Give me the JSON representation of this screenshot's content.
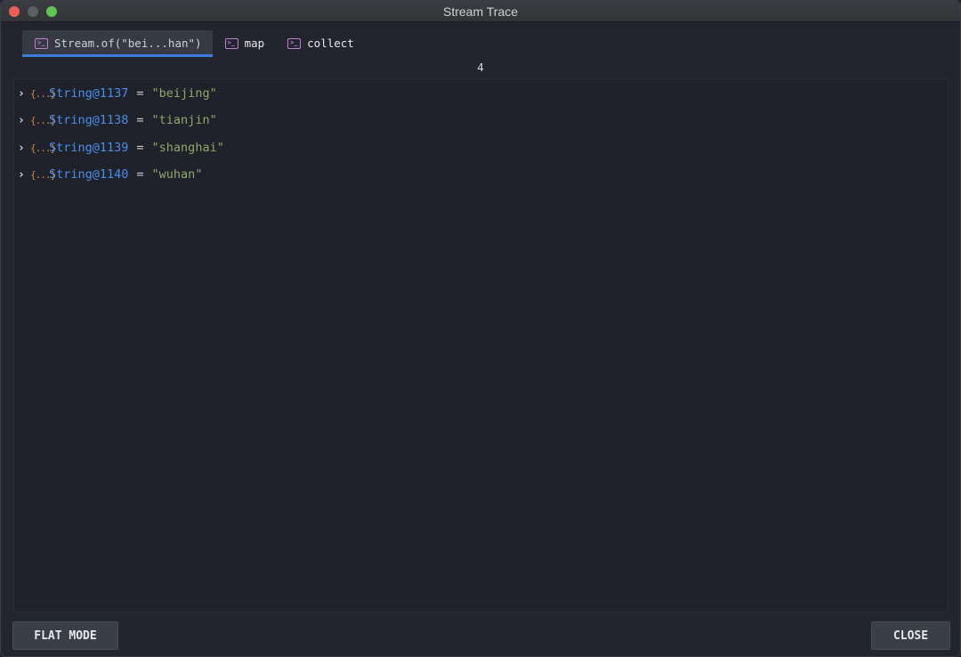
{
  "window": {
    "title": "Stream Trace"
  },
  "tabs": [
    {
      "label": "Stream.of(\"bei...han\")",
      "active": true
    },
    {
      "label": "map",
      "active": false
    },
    {
      "label": "collect",
      "active": false
    }
  ],
  "count": "4",
  "items": [
    {
      "ref": "String@1137",
      "eq": "=",
      "value": "\"beijing\""
    },
    {
      "ref": "String@1138",
      "eq": "=",
      "value": "\"tianjin\""
    },
    {
      "ref": "String@1139",
      "eq": "=",
      "value": "\"shanghai\""
    },
    {
      "ref": "String@1140",
      "eq": "=",
      "value": "\"wuhan\""
    }
  ],
  "buttons": {
    "flat_mode": "FLAT MODE",
    "close": "CLOSE"
  },
  "icons": {
    "tab": "console-icon",
    "expand": "chevron-right-icon",
    "object": "object-icon"
  },
  "colors": {
    "accent": "#3d7bdb",
    "ref": "#4b8ee8",
    "value": "#8ea86a",
    "tab_icon": "#c47fd5"
  }
}
